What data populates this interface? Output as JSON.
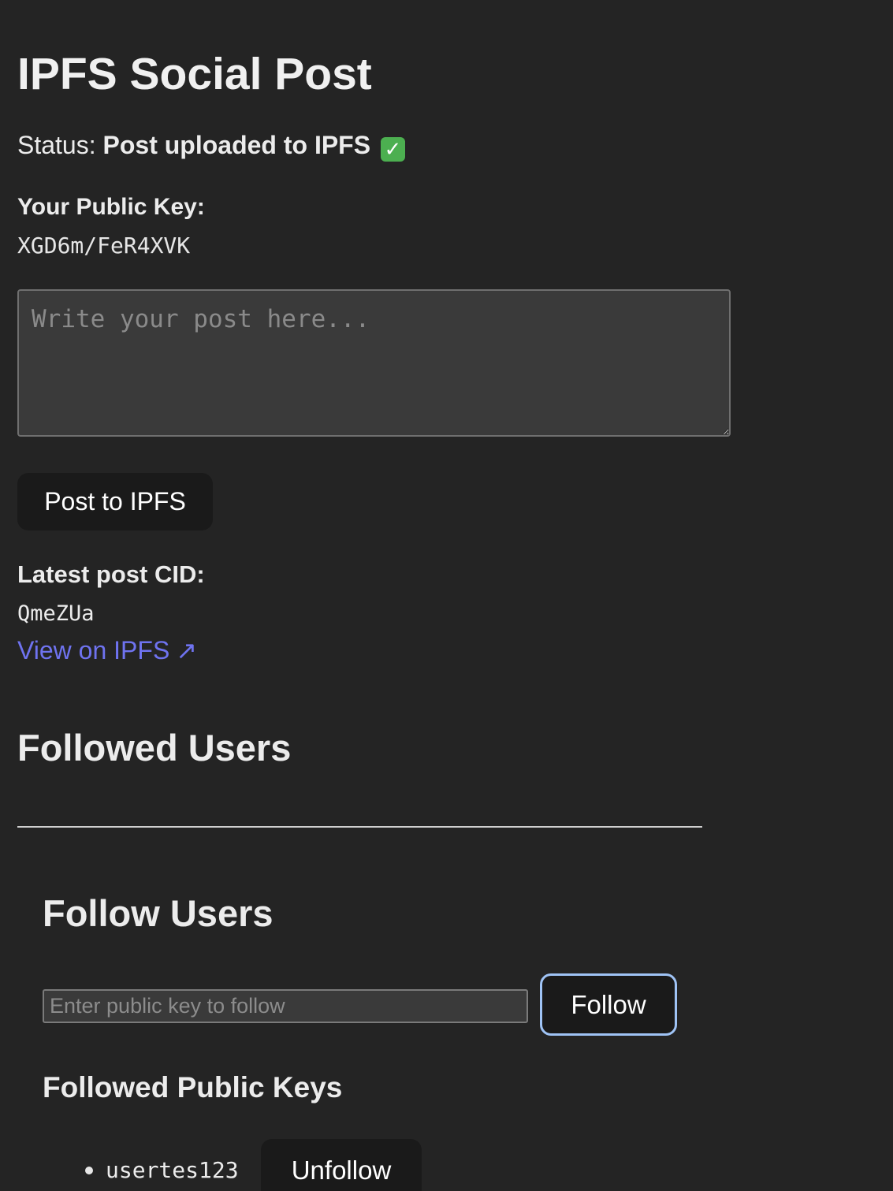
{
  "page": {
    "title": "IPFS Social Post"
  },
  "status": {
    "label": "Status:",
    "value": "Post uploaded to IPFS",
    "icon": "check-mark-icon"
  },
  "public_key": {
    "label": "Your Public Key:",
    "value": "XGD6m/FeR4XVK"
  },
  "composer": {
    "placeholder": "Write your post here...",
    "value": "",
    "post_button_label": "Post to IPFS"
  },
  "latest_post": {
    "label": "Latest post CID:",
    "cid": "QmeZUa",
    "link_label": "View on IPFS",
    "link_icon": "external-link-arrow-icon"
  },
  "followed_users": {
    "heading": "Followed Users"
  },
  "follow_users": {
    "heading": "Follow Users",
    "input_placeholder": "Enter public key to follow",
    "input_value": "",
    "follow_button_label": "Follow",
    "keys_heading": "Followed Public Keys",
    "keys": [
      {
        "key": "usertes123",
        "unfollow_label": "Unfollow"
      }
    ]
  },
  "colors": {
    "background": "#242424",
    "text": "#ececec",
    "link": "#6f73f0",
    "button_bg": "#1a1a1a",
    "focus_ring": "#9fc3f5",
    "check_green": "#4caf50"
  }
}
